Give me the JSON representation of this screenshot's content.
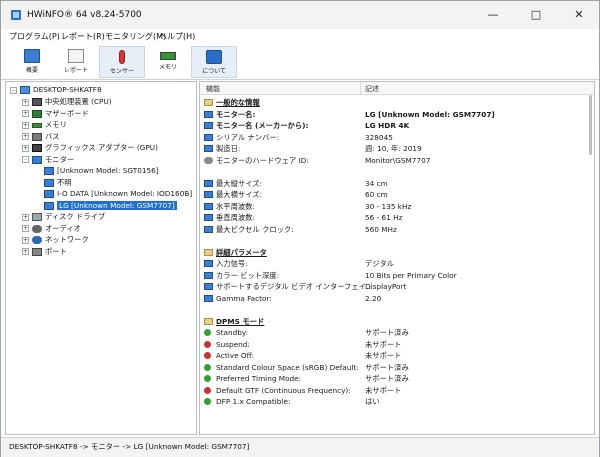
{
  "window": {
    "title": "HWiNFO® 64 v8.24-5700"
  },
  "menu": [
    {
      "label": "プログラム(P)"
    },
    {
      "label": "レポート(R)"
    },
    {
      "label": "モニタリング(M)"
    },
    {
      "label": "ヘルプ(H)"
    }
  ],
  "toolbar": [
    {
      "label": "概要",
      "icon": "monitor-icon"
    },
    {
      "label": "レポート",
      "icon": "report-icon"
    },
    {
      "label": "センサー",
      "icon": "sensor-icon"
    },
    {
      "label": "メモリ",
      "icon": "memory-icon"
    },
    {
      "label": "について",
      "icon": "about-icon"
    }
  ],
  "tree": {
    "root": "DESKTOP-SHKATF8",
    "items": [
      {
        "label": "中央処理装置 (CPU)",
        "icon": "cpu-icon",
        "expander": "+"
      },
      {
        "label": "マザーボード",
        "icon": "board-icon",
        "expander": "+"
      },
      {
        "label": "メモリ",
        "icon": "memory-icon",
        "expander": "+"
      },
      {
        "label": "バス",
        "icon": "bus-icon",
        "expander": "+"
      },
      {
        "label": "グラフィックス アダプター (GPU)",
        "icon": "gpu-icon",
        "expander": "+"
      },
      {
        "label": "モニター",
        "icon": "monitor-icon",
        "expander": "-"
      },
      {
        "label": "[Unknown Model: SGT0156]",
        "icon": "monitor-icon"
      },
      {
        "label": "不明",
        "icon": "monitor-icon"
      },
      {
        "label": "I-O DATA [Unknown Model: IOD160B]",
        "icon": "monitor-icon"
      },
      {
        "label": "LG [Unknown Model: GSM7707]",
        "icon": "monitor-icon",
        "selected": true
      },
      {
        "label": "ディスク ドライブ",
        "icon": "disk-icon",
        "expander": "+"
      },
      {
        "label": "オーディオ",
        "icon": "audio-icon",
        "expander": "+"
      },
      {
        "label": "ネットワーク",
        "icon": "network-icon",
        "expander": "+"
      },
      {
        "label": "ポート",
        "icon": "port-icon",
        "expander": "+"
      }
    ]
  },
  "details": {
    "col_field": "機能",
    "col_value": "記述",
    "rows": [
      {
        "type": "section",
        "field": "一般的な情報",
        "value": "",
        "icon": "section-icon"
      },
      {
        "type": "bold",
        "field": "モニター名:",
        "value": "LG [Unknown Model: GSM7707]",
        "icon": "monitor-icon"
      },
      {
        "type": "bold",
        "field": "モニター名 (メーカーから):",
        "value": "LG HDR 4K",
        "icon": "monitor-icon"
      },
      {
        "type": "normal",
        "field": "シリアル ナンバー:",
        "value": "328045",
        "icon": "monitor-icon"
      },
      {
        "type": "normal",
        "field": "製造日:",
        "value": "週: 10, 年: 2019",
        "icon": "monitor-icon"
      },
      {
        "type": "normal",
        "field": "モニターのハードウェア ID:",
        "value": "Monitor\\GSM7707",
        "icon": "gear-icon"
      },
      {
        "type": "gap"
      },
      {
        "type": "normal",
        "field": "最大縦サイズ:",
        "value": "34 cm",
        "icon": "monitor-icon"
      },
      {
        "type": "normal",
        "field": "最大横サイズ:",
        "value": "60 cm",
        "icon": "monitor-icon"
      },
      {
        "type": "normal",
        "field": "水平周波数:",
        "value": "30 - 135 kHz",
        "icon": "monitor-icon"
      },
      {
        "type": "normal",
        "field": "垂直周波数:",
        "value": "56 - 61 Hz",
        "icon": "monitor-icon"
      },
      {
        "type": "normal",
        "field": "最大ピクセル クロック:",
        "value": "560 MHz",
        "icon": "monitor-icon"
      },
      {
        "type": "gap"
      },
      {
        "type": "section",
        "field": "詳細パラメータ",
        "value": "",
        "icon": "section-icon"
      },
      {
        "type": "normal",
        "field": "入力信号:",
        "value": "デジタル",
        "icon": "monitor-icon"
      },
      {
        "type": "normal",
        "field": "カラー ビット深度:",
        "value": "10 Bits per Primary Color",
        "icon": "monitor-icon"
      },
      {
        "type": "normal",
        "field": "サポートするデジタル ビデオ インターフェイ...",
        "value": "DisplayPort",
        "icon": "monitor-icon"
      },
      {
        "type": "normal",
        "field": "Gamma Factor:",
        "value": "2.20",
        "icon": "monitor-icon"
      },
      {
        "type": "gap"
      },
      {
        "type": "section",
        "field": "DPMS モード",
        "value": "",
        "icon": "section-icon"
      },
      {
        "type": "normal",
        "field": "Standby:",
        "value": "サポート済み",
        "icon": "check-icon"
      },
      {
        "type": "normal",
        "field": "Suspend:",
        "value": "未サポート",
        "icon": "cross-icon"
      },
      {
        "type": "normal",
        "field": "Active Off:",
        "value": "未サポート",
        "icon": "cross-icon"
      },
      {
        "type": "normal",
        "field": "Standard Colour Space (sRGB) Default:",
        "value": "サポート済み",
        "icon": "check-icon"
      },
      {
        "type": "normal",
        "field": "Preferred Timing Mode:",
        "value": "サポート済み",
        "icon": "check-icon"
      },
      {
        "type": "normal",
        "field": "Default GTF (Continuous Frequency):",
        "value": "未サポート",
        "icon": "cross-icon"
      },
      {
        "type": "normal",
        "field": "DFP 1.x Compatible:",
        "value": "はい",
        "icon": "check-icon"
      }
    ]
  },
  "status": {
    "text": "DESKTOP-SHKATF8 -> モニター -> LG [Unknown Model: GSM7707]"
  }
}
